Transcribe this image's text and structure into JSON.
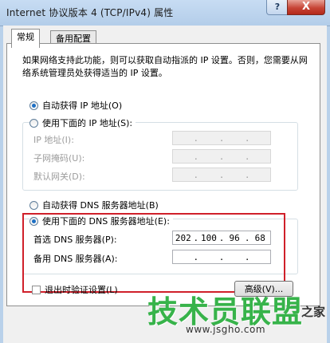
{
  "window": {
    "title": "Internet 协议版本 4 (TCP/IPv4) 属性",
    "help": "?",
    "close": "X"
  },
  "tabs": [
    {
      "label": "常规"
    },
    {
      "label": "备用配置"
    }
  ],
  "description": "如果网络支持此功能，则可以获取自动指派的 IP 设置。否则，您需要从网络系统管理员处获得适当的 IP 设置。",
  "ip_section": {
    "auto_label": "自动获得 IP 地址(O)",
    "manual_label": "使用下面的 IP 地址(S):",
    "fields": [
      {
        "label": "IP 地址(I):",
        "octets": [
          "",
          "",
          "",
          ""
        ]
      },
      {
        "label": "子网掩码(U):",
        "octets": [
          "",
          "",
          "",
          ""
        ]
      },
      {
        "label": "默认网关(D):",
        "octets": [
          "",
          "",
          "",
          ""
        ]
      }
    ]
  },
  "dns_section": {
    "auto_label": "自动获得 DNS 服务器地址(B)",
    "manual_label": "使用下面的 DNS 服务器地址(E):",
    "preferred": {
      "label": "首选 DNS 服务器(P):",
      "octets": [
        "202",
        "100",
        "96",
        "68"
      ]
    },
    "alternate": {
      "label": "备用 DNS 服务器(A):",
      "octets": [
        "",
        "",
        "",
        ""
      ]
    }
  },
  "validate": {
    "label": "退出时验证设置(L)",
    "checked": false
  },
  "advanced_button": "高级(V)...",
  "watermark": {
    "brand": "技术员联盟",
    "side": "之家",
    "url": "www.jsgho.com"
  },
  "colors": {
    "highlight": "#d0202a",
    "radio_dot": "#1d6fc4"
  }
}
